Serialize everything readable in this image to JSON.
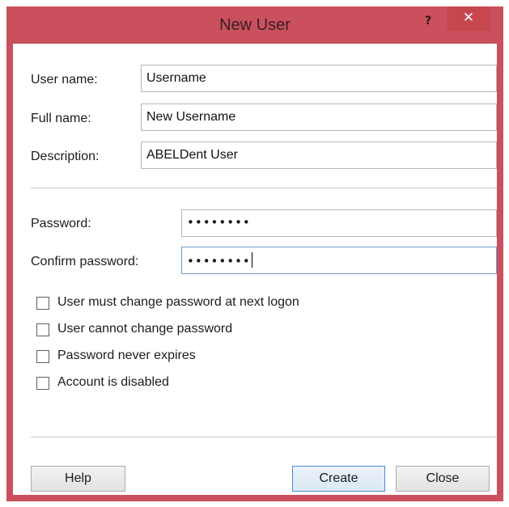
{
  "window": {
    "title": "New User",
    "help_glyph": "?",
    "close_glyph": "✕"
  },
  "form": {
    "user_name_label": "User name:",
    "user_name_value": "Username",
    "full_name_label": "Full name:",
    "full_name_value": "New Username",
    "description_label": "Description:",
    "description_value": "ABELDent User",
    "password_label": "Password:",
    "password_value": "••••••••",
    "confirm_password_label": "Confirm password:",
    "confirm_password_value": "••••••••"
  },
  "options": [
    {
      "label": "User must change password at next logon",
      "checked": false
    },
    {
      "label": "User cannot change password",
      "checked": false
    },
    {
      "label": "Password never expires",
      "checked": false
    },
    {
      "label": "Account is disabled",
      "checked": false
    }
  ],
  "buttons": {
    "help": "Help",
    "create": "Create",
    "close": "Close"
  },
  "colors": {
    "titlebar": "#c9505c",
    "close_button": "#c7474f",
    "focus_border": "#6c9fcf"
  },
  "icons": {
    "help": "question-mark-icon",
    "close": "close-icon"
  }
}
